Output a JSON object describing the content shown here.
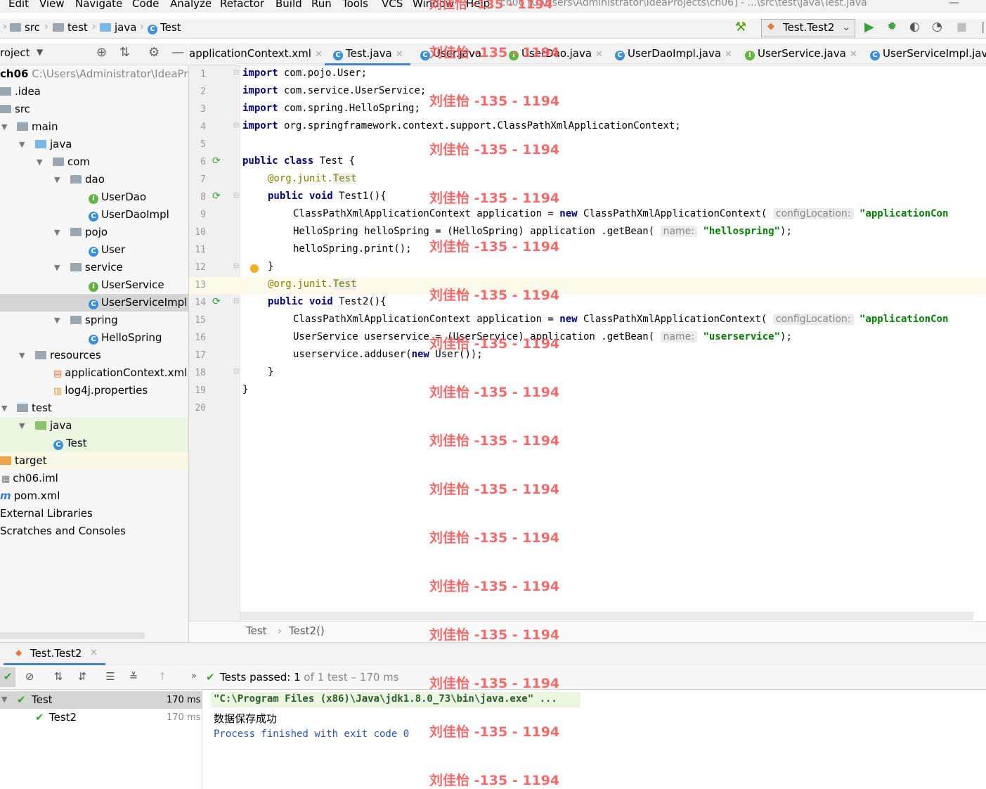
{
  "menubar": {
    "items": [
      "Edit",
      "View",
      "Navigate",
      "Code",
      "Analyze",
      "Refactor",
      "Build",
      "Run",
      "Tools",
      "VCS",
      "Window",
      "Help"
    ],
    "title": "ch06 [C:\\Users\\Administrator\\IdeaProjects\\ch06] - ...\\src\\test\\java\\Test.java"
  },
  "breadcrumb": [
    "src",
    "test",
    "java",
    "Test"
  ],
  "run_config": "Test.Test2",
  "project": {
    "header": "roject",
    "root_name": "ch06",
    "root_path": "C:\\Users\\Administrator\\IdeaPro",
    "tree": [
      "ch06",
      ".idea",
      "src",
      "main",
      "java",
      "com",
      "dao",
      "UserDao",
      "UserDaoImpl",
      "pojo",
      "User",
      "service",
      "UserService",
      "UserServiceImpl",
      "spring",
      "HelloSpring",
      "resources",
      "applicationContext.xml",
      "log4j.properties",
      "test",
      "java",
      "Test",
      "target",
      "ch06.iml",
      "pom.xml",
      "External Libraries",
      "Scratches and Consoles"
    ]
  },
  "tabs": [
    "applicationContext.xml",
    "Test.java",
    "User.java",
    "UserDao.java",
    "UserDaoImpl.java",
    "UserService.java",
    "UserServiceImpl.java"
  ],
  "editor": {
    "line_numbers": [
      "1",
      "2",
      "3",
      "4",
      "5",
      "6",
      "7",
      "8",
      "9",
      "10",
      "11",
      "12",
      "13",
      "14",
      "15",
      "16",
      "17",
      "18",
      "19",
      "20"
    ],
    "lines": [
      {
        "kw": "import",
        "rest": " com.pojo.User;"
      },
      {
        "kw": "import",
        "rest": " com.service.UserService;"
      },
      {
        "kw": "import",
        "rest": " com.spring.HelloSpring;"
      },
      {
        "kw": "import",
        "rest": " org.springframework.context.support.ClassPathXmlApplicationContext;"
      }
    ],
    "l6_kw": "public class",
    "l6_rest": " Test {",
    "ann_prefix": "@org.junit.",
    "ann_name": "Test",
    "l8_kw": "public void",
    "l8_rest": " Test1(){",
    "l9_a": "ClassPathXmlApplicationContext application = ",
    "kw_new": "new",
    "l9_b": " ClassPathXmlApplicationContext(",
    "hint_config": "configLocation:",
    "str_appcon": "\"applicationCon",
    "l10_a": "HelloSpring helloSpring = (HelloSpring) application .getBean(",
    "hint_name": "name:",
    "str_hello": "\"hellospring\"",
    "close_paren": ");",
    "l11": "helloSpring.print();",
    "brace": "}",
    "l14_rest": " Test2(){",
    "l16_a": "UserService userservice = (UserService) application .getBean(",
    "str_user": "\"userservice\"",
    "l17_a": "userservice.adduser(",
    "l17_b": " User());"
  },
  "editor_breadcrumb": [
    "Test",
    "Test2()"
  ],
  "watermark": "刘佳怡 -135 - 1194",
  "run": {
    "tab": "Test.Test2",
    "status_label": "Tests passed:",
    "status_count": "1",
    "status_rest": "of 1 test – 170 ms",
    "results": [
      {
        "name": "Test",
        "time": "170 ms"
      },
      {
        "name": "Test2",
        "time": "170 ms"
      }
    ],
    "console": [
      "\"C:\\Program Files (x86)\\Java\\jdk1.8.0_73\\bin\\java.exe\" ...",
      "数据保存成功",
      "Process finished with exit code 0"
    ]
  },
  "colors": {
    "keyword": "#000080",
    "string": "#008000",
    "annotation": "#808000",
    "watermark": "#f45c5c",
    "accent": "#4083c9"
  }
}
